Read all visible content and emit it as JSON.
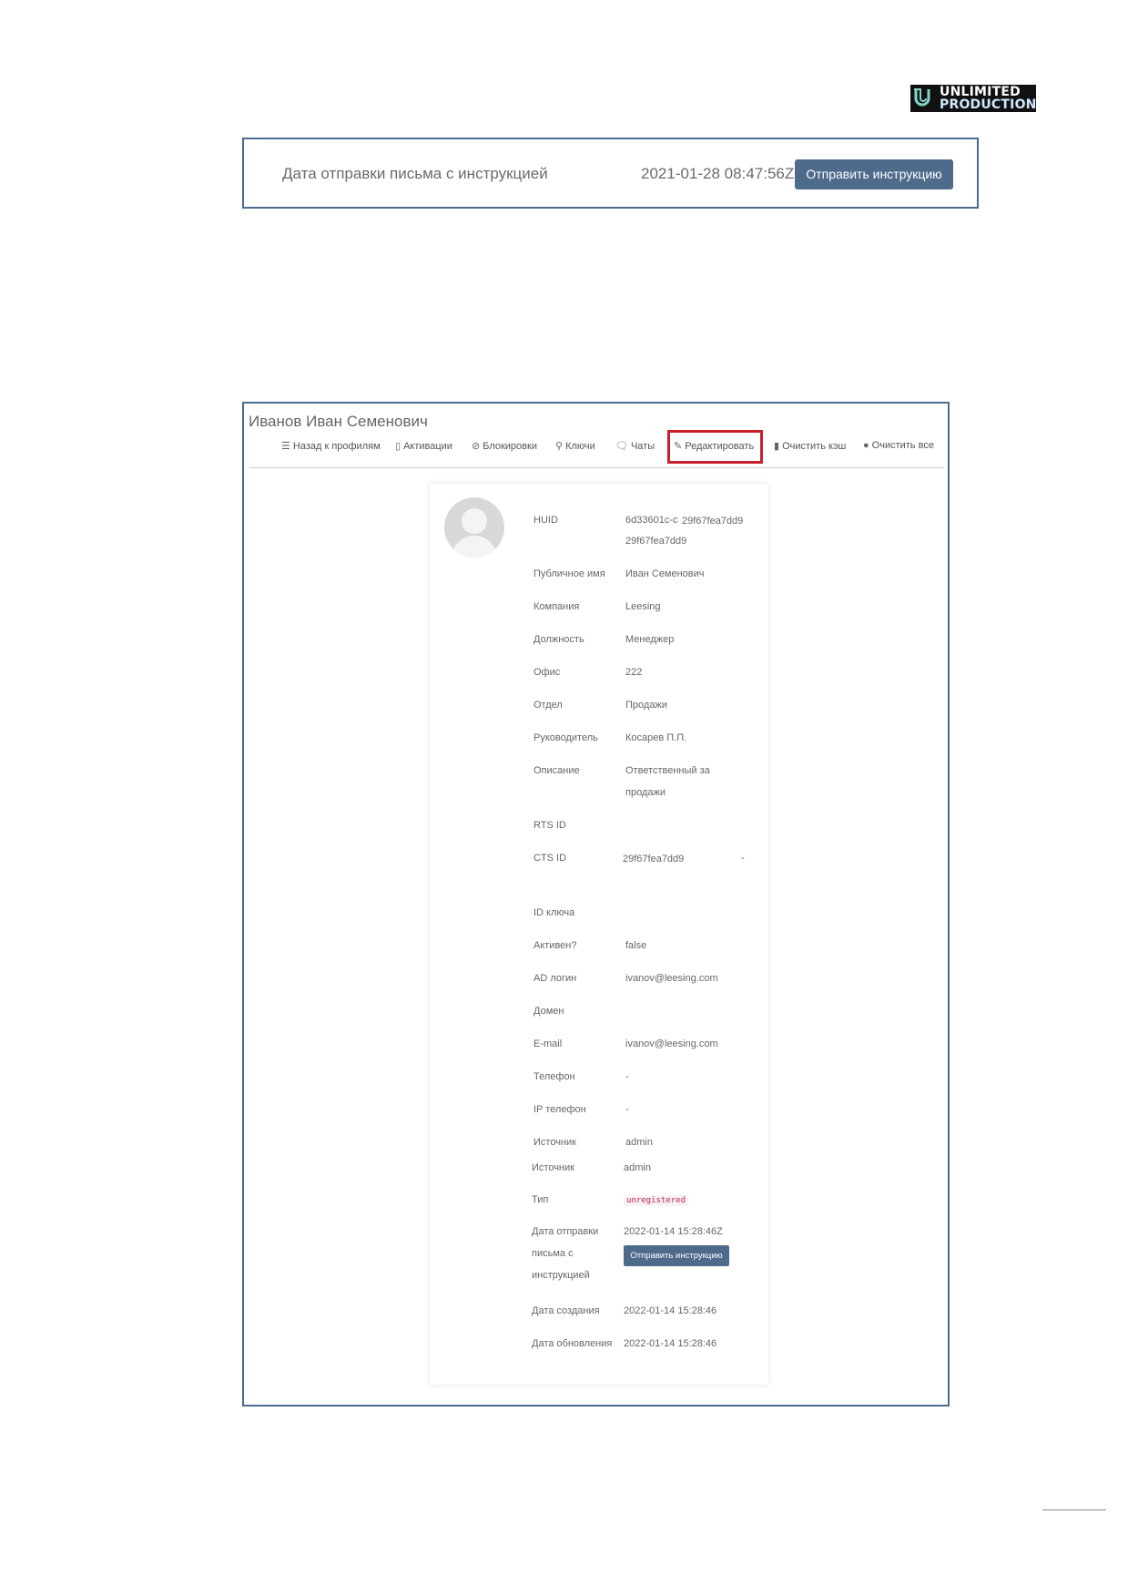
{
  "logo": {
    "line1": "UNLIMITED",
    "line2": "PRODUCTION"
  },
  "top_panel": {
    "label": "Дата отправки письма с инструкцией",
    "value": "2021-01-28 08:47:56Z",
    "button": "Отправить инструкцию"
  },
  "profile": {
    "title": "Иванов Иван Семенович",
    "nav": [
      {
        "icon": "list-icon",
        "glyph": "☰",
        "label": "Назад к профилям"
      },
      {
        "icon": "mobile-icon",
        "glyph": "▯",
        "label": "Активации"
      },
      {
        "icon": "ban-icon",
        "glyph": "⊘",
        "label": "Блокировки"
      },
      {
        "icon": "key-icon",
        "glyph": "⚲",
        "label": "Ключи"
      },
      {
        "icon": "chat-icon",
        "glyph": "🗨",
        "label": "Чаты"
      },
      {
        "icon": "pencil-icon",
        "glyph": "✎",
        "label": "Редактировать"
      },
      {
        "icon": "broom-icon",
        "glyph": "▮",
        "label": "Очистить кэш"
      },
      {
        "icon": "bomb-icon",
        "glyph": "●",
        "label": "Очистить все"
      }
    ],
    "fields": {
      "huid": {
        "label": "HUID",
        "value_a": "6d33601c-c",
        "value_b": "29f67fea7dd9",
        "value_c": "29f67fea7dd9"
      },
      "public_name": {
        "label": "Публичное имя",
        "value": "Иван Семенович"
      },
      "company": {
        "label": "Компания",
        "value": "Leesing"
      },
      "position": {
        "label": "Должность",
        "value": "Менеджер"
      },
      "office": {
        "label": "Офис",
        "value": "222"
      },
      "department": {
        "label": "Отдел",
        "value": "Продажи"
      },
      "manager": {
        "label": "Руководитель",
        "value": "Косарев П.П."
      },
      "description": {
        "label": "Описание",
        "value": "Ответственный за продажи"
      },
      "rts_id": {
        "label": "RTS ID",
        "value": ""
      },
      "cts_id": {
        "label": "CTS ID",
        "value": "29f67fea7dd9",
        "suffix": "-"
      },
      "key_id": {
        "label": "ID ключа",
        "value": ""
      },
      "active": {
        "label": "Активен?",
        "value": "false"
      },
      "ad_login": {
        "label": "AD логин",
        "value": "ivanov@leesing.com"
      },
      "domain": {
        "label": "Домен",
        "value": ""
      },
      "email": {
        "label": "E-mail",
        "value": "ivanov@leesing.com"
      },
      "phone": {
        "label": "Телефон",
        "value": "-"
      },
      "ip_phone": {
        "label": "IP телефон",
        "value": "-"
      },
      "source1": {
        "label": "Источник",
        "value": "admin"
      },
      "source2": {
        "label": "Источник",
        "value": "admin"
      },
      "type": {
        "label": "Тип",
        "value": "unregistered"
      },
      "sent_date": {
        "label": "Дата отправки письма с инструкцией",
        "value": "2022-01-14 15:28:46Z",
        "button": "Отправить инструкцию"
      },
      "created": {
        "label": "Дата создания",
        "value": "2022-01-14 15:28:46"
      },
      "updated": {
        "label": "Дата обновления",
        "value": "2022-01-14 15:28:46"
      }
    }
  }
}
